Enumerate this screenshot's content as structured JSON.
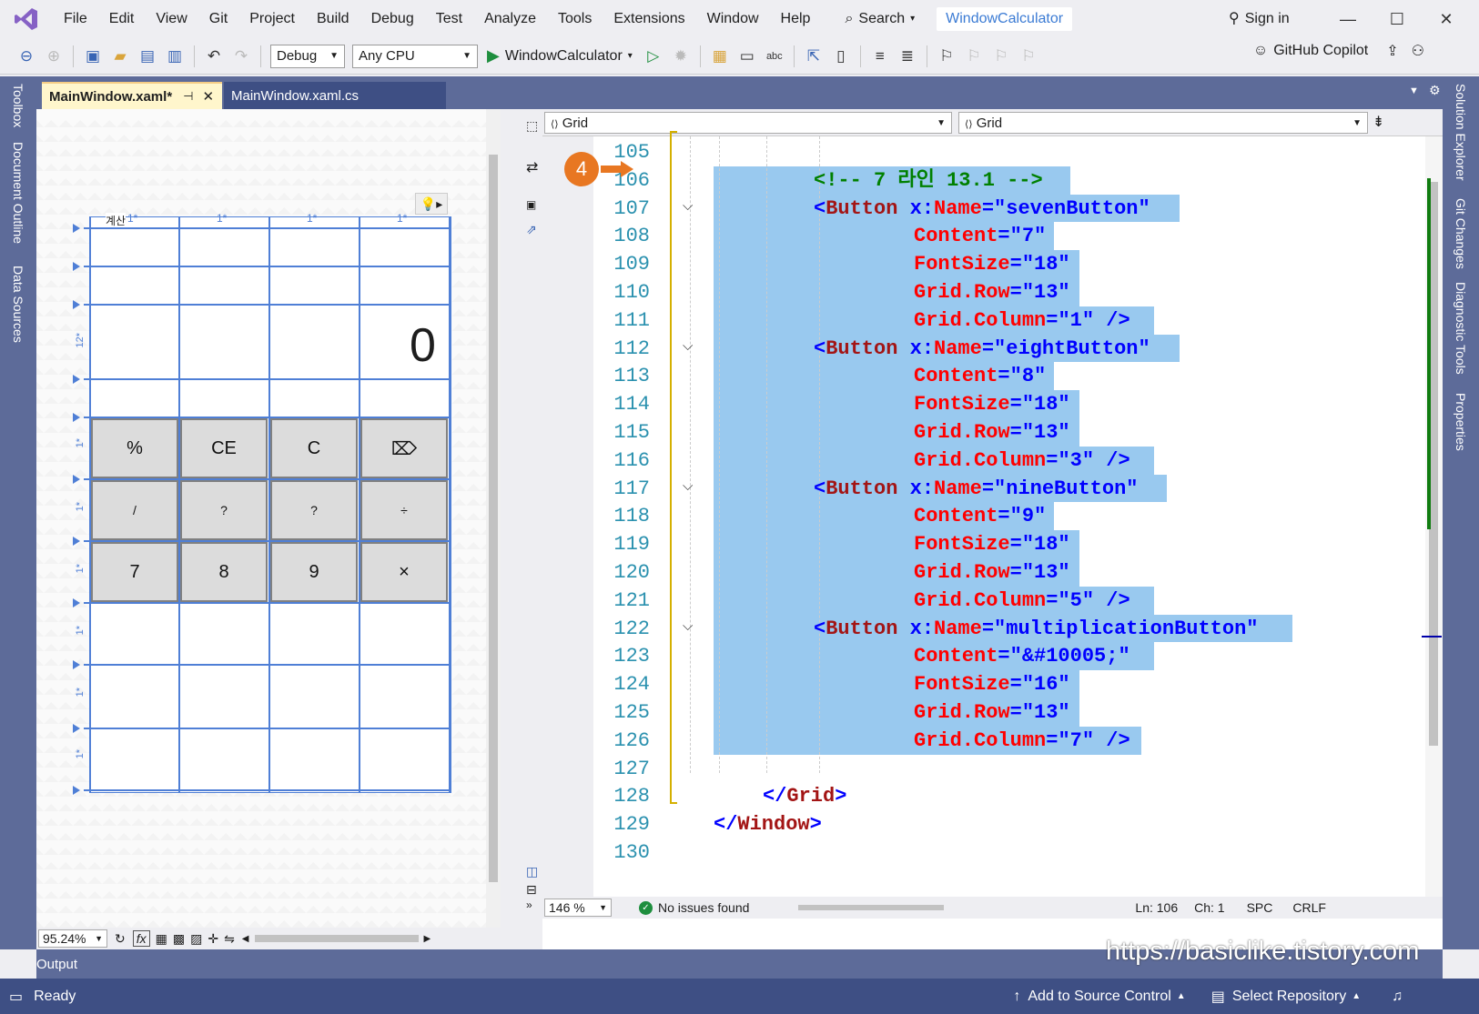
{
  "menu": [
    "File",
    "Edit",
    "View",
    "Git",
    "Project",
    "Build",
    "Debug",
    "Test",
    "Analyze",
    "Tools",
    "Extensions",
    "Window",
    "Help"
  ],
  "search_label": "Search",
  "project_title": "WindowCalculator",
  "sign_in": "Sign in",
  "toolbar": {
    "config": "Debug",
    "platform": "Any CPU",
    "run_target": "WindowCalculator",
    "copilot": "GitHub Copilot"
  },
  "left_rail": [
    "Toolbox",
    "Document Outline",
    "Data Sources"
  ],
  "right_rail": [
    "Solution Explorer",
    "Git Changes",
    "Diagnostic Tools",
    "Properties"
  ],
  "tabs": [
    {
      "label": "MainWindow.xaml*",
      "active": true
    },
    {
      "label": "MainWindow.xaml.cs",
      "active": false
    }
  ],
  "designer": {
    "window_title": "계산",
    "col_labels": [
      "1*",
      "1*",
      "1*",
      "1*"
    ],
    "row_labels": [
      "12*",
      "1*",
      "1*",
      "1*",
      "1*",
      "1*",
      "1*"
    ],
    "display_value": "0",
    "buttons": [
      "%",
      "CE",
      "C",
      "⌦",
      "/",
      "?",
      "?",
      "÷",
      "7",
      "8",
      "9",
      "×"
    ],
    "zoom": "95.24%",
    "fx": "fx"
  },
  "nav": {
    "left": "Grid",
    "right": "Grid"
  },
  "annotation_badge": "4",
  "line_numbers": [
    "105",
    "106",
    "107",
    "108",
    "109",
    "110",
    "111",
    "112",
    "113",
    "114",
    "115",
    "116",
    "117",
    "118",
    "119",
    "120",
    "121",
    "122",
    "123",
    "124",
    "125",
    "126",
    "127",
    "128",
    "129",
    "130"
  ],
  "code": {
    "comment": "<!-- 7 라인 13.1 -->",
    "b1": {
      "open": "<Button",
      "attr": "x:Name",
      "val": "\"sevenButton\""
    },
    "b1c": {
      "attr": "Content",
      "val": "\"7\""
    },
    "b1f": {
      "attr": "FontSize",
      "val": "\"18\""
    },
    "b1r": {
      "attr": "Grid.Row",
      "val": "\"13\""
    },
    "b1col": {
      "attr": "Grid.Column",
      "val": "\"1\"",
      "close": "/>"
    },
    "b2": {
      "open": "<Button",
      "attr": "x:Name",
      "val": "\"eightButton\""
    },
    "b2c": {
      "attr": "Content",
      "val": "\"8\""
    },
    "b2f": {
      "attr": "FontSize",
      "val": "\"18\""
    },
    "b2r": {
      "attr": "Grid.Row",
      "val": "\"13\""
    },
    "b2col": {
      "attr": "Grid.Column",
      "val": "\"3\"",
      "close": "/>"
    },
    "b3": {
      "open": "<Button",
      "attr": "x:Name",
      "val": "\"nineButton\""
    },
    "b3c": {
      "attr": "Content",
      "val": "\"9\""
    },
    "b3f": {
      "attr": "FontSize",
      "val": "\"18\""
    },
    "b3r": {
      "attr": "Grid.Row",
      "val": "\"13\""
    },
    "b3col": {
      "attr": "Grid.Column",
      "val": "\"5\"",
      "close": "/>"
    },
    "b4": {
      "open": "<Button",
      "attr": "x:Name",
      "val": "\"multiplicationButton\""
    },
    "b4c": {
      "attr": "Content",
      "val": "\"&#10005;\""
    },
    "b4f": {
      "attr": "FontSize",
      "val": "\"16\""
    },
    "b4r": {
      "attr": "Grid.Row",
      "val": "\"13\""
    },
    "b4col": {
      "attr": "Grid.Column",
      "val": "\"7\"",
      "close": "/>"
    },
    "grid_close": "</Grid>",
    "window_close": "</Window>"
  },
  "editor_status": {
    "zoom": "146 %",
    "issues": "No issues found",
    "ln": "Ln: 106",
    "ch": "Ch: 1",
    "spc": "SPC",
    "crlf": "CRLF"
  },
  "output_tab": "Output",
  "status": {
    "ready": "Ready",
    "source_control": "Add to Source Control",
    "repo": "Select Repository"
  },
  "watermark": "https://basiclike.tistory.com"
}
